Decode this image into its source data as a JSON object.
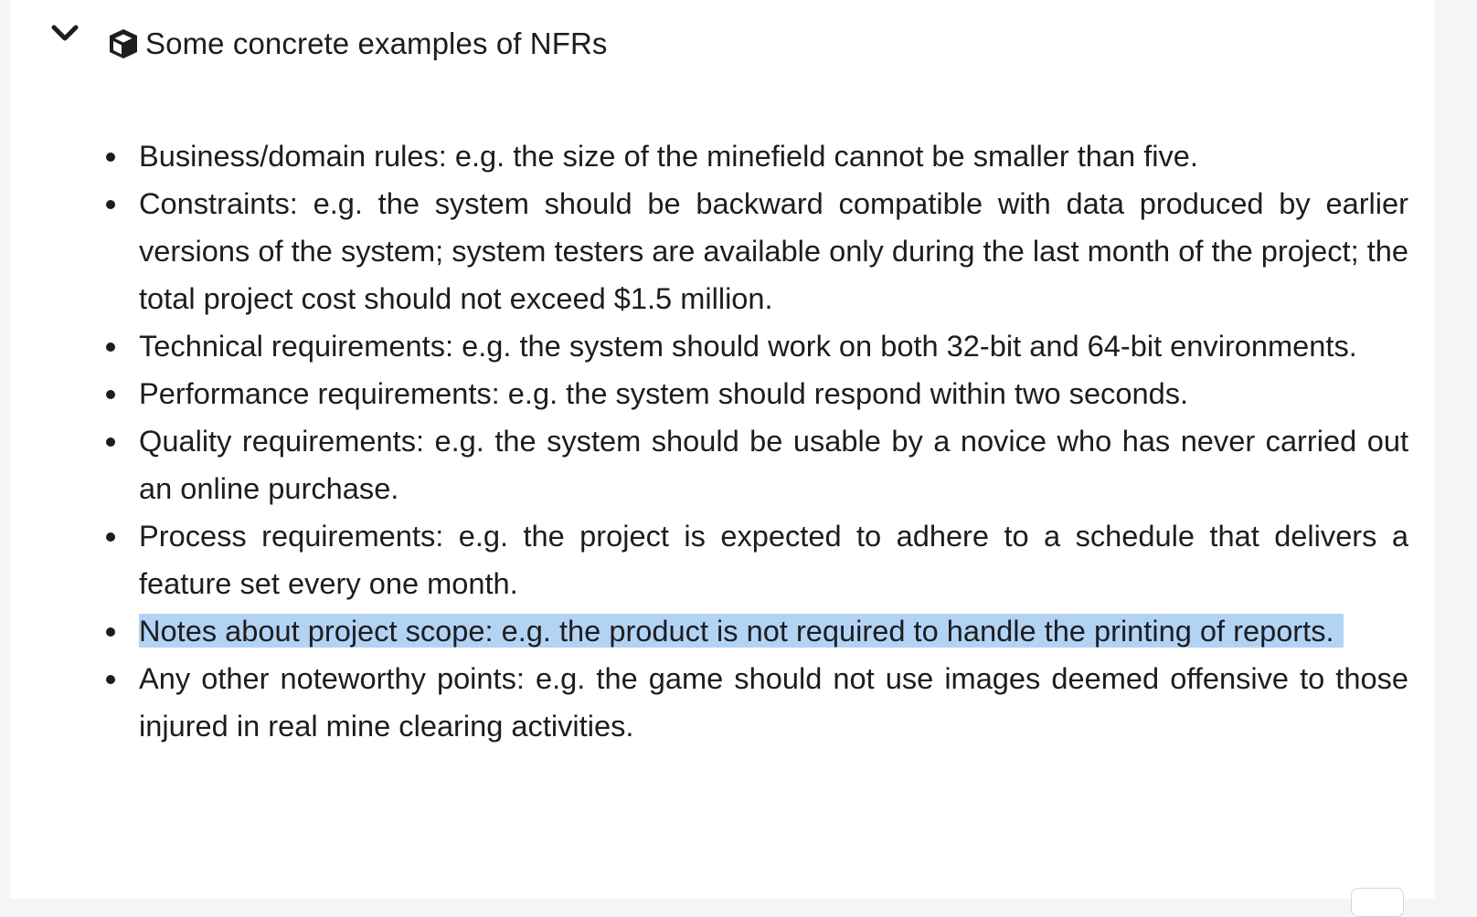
{
  "section": {
    "title": "Some concrete examples of NFRs",
    "toggle_icon": "chevron-down-icon",
    "title_icon": "cube-icon"
  },
  "items": [
    {
      "label": "Business/domain rules: e.g. the size of the minefield cannot be smaller than five."
    },
    {
      "label": "Constraints: e.g. the system should be backward compatible with data produced by earlier versions of the system; system testers are available only during the last month of the project; the total project cost should not exceed $1.5 million."
    },
    {
      "label": "Technical requirements: e.g. the system should work on both 32-bit and 64-bit environments."
    },
    {
      "label": "Performance requirements: e.g. the system should respond within two seconds."
    },
    {
      "label": "Quality requirements: e.g. the system should be usable by a novice who has never carried out an online purchase."
    },
    {
      "label": "Process requirements: e.g. the project is expected to adhere to a schedule that delivers a feature set every one month."
    },
    {
      "label": "Notes about project scope: e.g. the product is not required to handle the printing of reports.",
      "selected": true
    },
    {
      "label": "Any other noteworthy points: e.g. the game should not use images deemed offensive to those injured in real mine clearing activities."
    }
  ],
  "colors": {
    "selection": "#b3d3f5",
    "text": "#1d1d1f",
    "background": "#ffffff"
  }
}
